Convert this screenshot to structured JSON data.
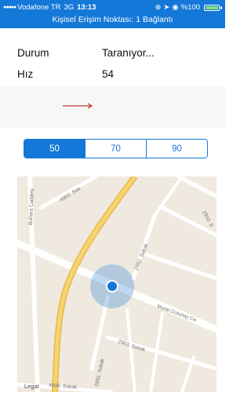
{
  "status_bar": {
    "signal": "●●●●●",
    "carrier": "Vodafone TR",
    "network": "3G",
    "time": "13:13",
    "battery_pct": "%100",
    "hotspot": "Kişisel Erişim Noktası: 1 Bağlantı"
  },
  "info": {
    "status_label": "Durum",
    "status_value": "Taranıyor...",
    "speed_label": "Hız",
    "speed_value": "54"
  },
  "segmented": {
    "options": [
      "50",
      "70",
      "90"
    ],
    "selected_index": 0
  },
  "map": {
    "streets": {
      "s1": "4902. Sok",
      "s2": "Buhara Caddesi",
      "s3": "2910. S",
      "s4": "2982. Sokak",
      "s5": "Murat Dolunay Ca",
      "s6": "2963. Sokak",
      "s7": "2991. Sokak",
      "s8": "4906. Sokak"
    },
    "legal": "Legal"
  },
  "colors": {
    "accent": "#1478d8",
    "arrow": "#c0392b",
    "map_bg": "#efe9df",
    "main_road": "#f2c44a",
    "location": "#1478d8"
  }
}
